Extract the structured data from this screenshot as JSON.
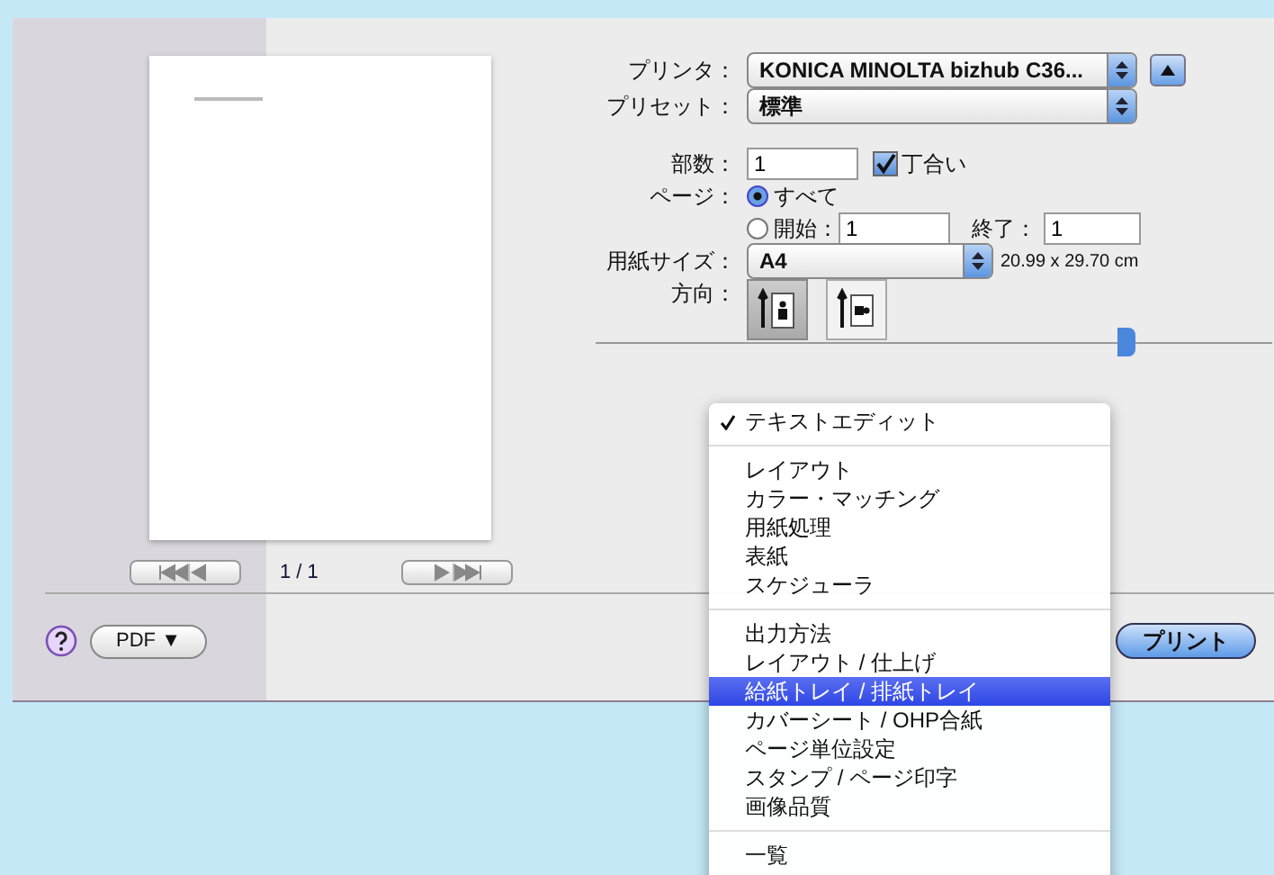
{
  "preview": {
    "page_indicator": "1 / 1"
  },
  "form": {
    "printer": {
      "label": "プリンタ：",
      "value": "KONICA MINOLTA bizhub C36..."
    },
    "preset": {
      "label": "プリセット：",
      "value": "標準"
    },
    "copies": {
      "label": "部数：",
      "value": "1",
      "collate": {
        "label": "丁合い",
        "checked": true
      }
    },
    "pages": {
      "label": "ページ：",
      "options": [
        {
          "label": "すべて",
          "selected": true
        },
        {
          "label": "開始：",
          "selected": false
        }
      ],
      "from": "1",
      "to_label": "終了：",
      "to": "1"
    },
    "paper_size": {
      "label": "用紙サイズ：",
      "value": "A4",
      "dimensions": "20.99 x 29.70 cm"
    },
    "orientation": {
      "label": "方向：",
      "options": [
        {
          "kind": "portrait",
          "selected": true
        },
        {
          "kind": "landscape",
          "selected": false
        }
      ]
    }
  },
  "menu": [
    {
      "kind": "item",
      "label": "テキストエディット",
      "checked": true,
      "selected": false
    },
    {
      "kind": "separator"
    },
    {
      "kind": "item",
      "label": "レイアウト",
      "checked": false,
      "selected": false
    },
    {
      "kind": "item",
      "label": "カラー・マッチング",
      "checked": false,
      "selected": false
    },
    {
      "kind": "item",
      "label": "用紙処理",
      "checked": false,
      "selected": false
    },
    {
      "kind": "item",
      "label": "表紙",
      "checked": false,
      "selected": false
    },
    {
      "kind": "item",
      "label": "スケジューラ",
      "checked": false,
      "selected": false
    },
    {
      "kind": "separator"
    },
    {
      "kind": "item",
      "label": "出力方法",
      "checked": false,
      "selected": false
    },
    {
      "kind": "item",
      "label": "レイアウト / 仕上げ",
      "checked": false,
      "selected": false
    },
    {
      "kind": "item",
      "label": "給紙トレイ / 排紙トレイ",
      "checked": false,
      "selected": true
    },
    {
      "kind": "item",
      "label": "カバーシート / OHP合紙",
      "checked": false,
      "selected": false
    },
    {
      "kind": "item",
      "label": "ページ単位設定",
      "checked": false,
      "selected": false
    },
    {
      "kind": "item",
      "label": "スタンプ / ページ印字",
      "checked": false,
      "selected": false
    },
    {
      "kind": "item",
      "label": "画像品質",
      "checked": false,
      "selected": false
    },
    {
      "kind": "separator"
    },
    {
      "kind": "item",
      "label": "一覧",
      "checked": false,
      "selected": false
    }
  ],
  "bottom": {
    "pdf_button": "PDF ▼",
    "print_button": "プリント"
  }
}
